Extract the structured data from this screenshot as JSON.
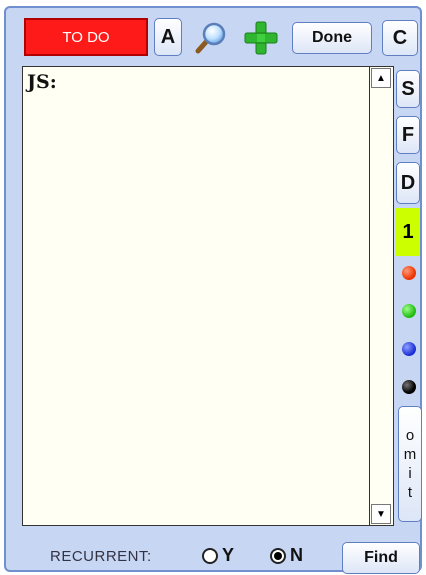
{
  "toolbar": {
    "todo_label": "TO DO",
    "a_label": "A",
    "search_icon": "magnifier-icon",
    "add_icon": "plus-icon",
    "done_label": "Done",
    "c_label": "C"
  },
  "editor": {
    "text": "JS:",
    "scroll_up": "▲",
    "scroll_down": "▼"
  },
  "sidebar": {
    "s_label": "S",
    "f_label": "F",
    "d_label": "D",
    "priority_label": "1",
    "priority_color": "#ccff00",
    "dots": [
      "#ee3300",
      "#22bb11",
      "#1c2fd6",
      "#000000"
    ],
    "omit_letters": [
      "o",
      "m",
      "i",
      "t"
    ]
  },
  "footer": {
    "recurrent_label": "RECURRENT:",
    "yes_label": "Y",
    "no_label": "N",
    "selected": "N",
    "find_label": "Find"
  },
  "colors": {
    "panel_bg": "#c7d6f2",
    "panel_border": "#6f8fcf",
    "todo_bg": "#ff1a1a"
  }
}
